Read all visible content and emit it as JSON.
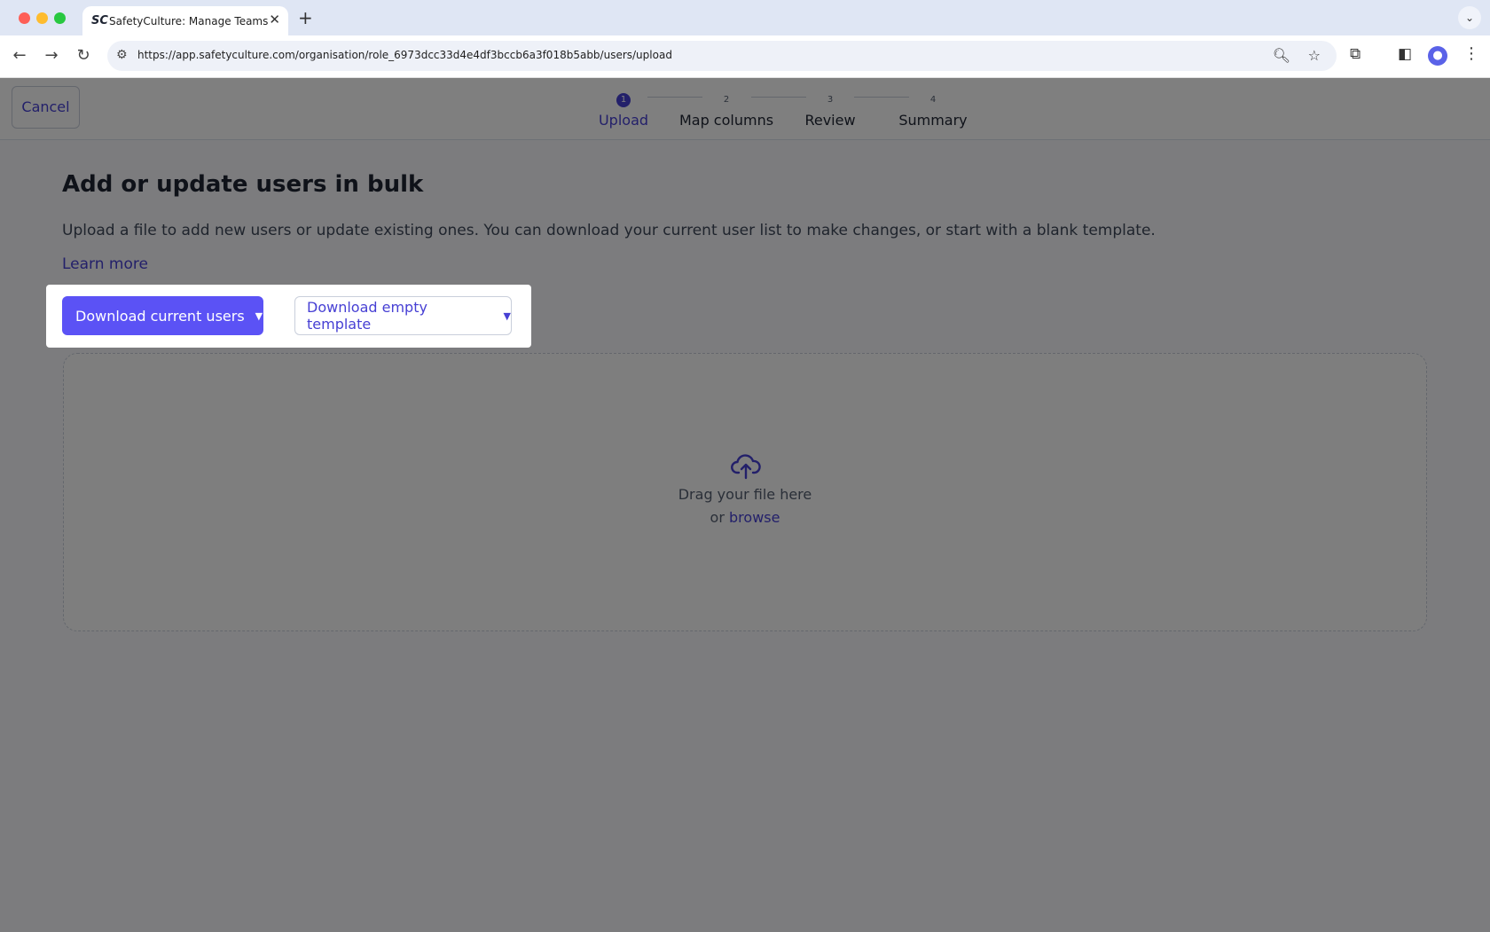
{
  "browser": {
    "tab_favicon": "SC",
    "tab_title": "SafetyCulture: Manage Teams and...",
    "url": "https://app.safetyculture.com/organisation/role_6973dcc33d4e4df3bccb6a3f018b5abb/users/upload"
  },
  "header": {
    "cancel_label": "Cancel",
    "steps": [
      {
        "num": "1",
        "label": "Upload"
      },
      {
        "num": "2",
        "label": "Map columns"
      },
      {
        "num": "3",
        "label": "Review"
      },
      {
        "num": "4",
        "label": "Summary"
      }
    ]
  },
  "main": {
    "title": "Add or update users in bulk",
    "description": "Upload a file to add new users or update existing ones. You can download your current user list to make changes, or start with a blank template.",
    "learn_more": "Learn more",
    "download_current": "Download current users",
    "download_template": "Download empty template",
    "dropzone": {
      "drag_text": "Drag your file here",
      "or_text": "or",
      "browse_text": "browse"
    }
  },
  "colors": {
    "accent": "#4740d4",
    "primary_button": "#5b52f5"
  }
}
